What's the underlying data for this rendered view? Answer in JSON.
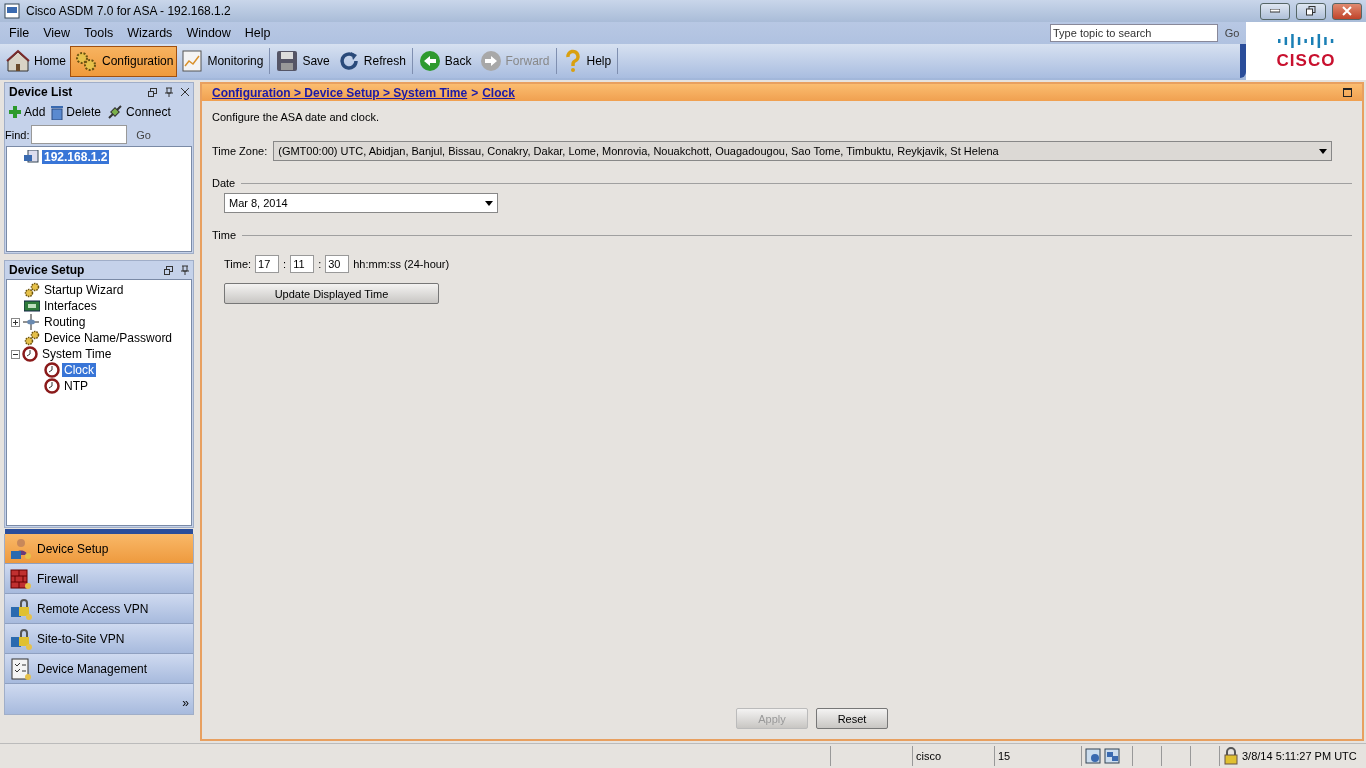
{
  "window": {
    "title": "Cisco ASDM 7.0 for ASA - 192.168.1.2"
  },
  "menu": [
    "File",
    "View",
    "Tools",
    "Wizards",
    "Window",
    "Help"
  ],
  "toolbar": [
    {
      "label": "Home",
      "kind": "home",
      "selected": false,
      "disabled": false
    },
    {
      "label": "Configuration",
      "kind": "gears",
      "selected": true,
      "disabled": false
    },
    {
      "label": "Monitoring",
      "kind": "chart",
      "selected": false,
      "disabled": false
    },
    {
      "label": "Save",
      "kind": "disk",
      "selected": false,
      "disabled": false
    },
    {
      "label": "Refresh",
      "kind": "refresh",
      "selected": false,
      "disabled": false
    },
    {
      "label": "Back",
      "kind": "back",
      "selected": false,
      "disabled": false
    },
    {
      "label": "Forward",
      "kind": "forward",
      "selected": false,
      "disabled": true
    },
    {
      "label": "Help",
      "kind": "question",
      "selected": false,
      "disabled": false
    }
  ],
  "search": {
    "placeholder": "Type topic to search",
    "button": "Go"
  },
  "logo": "CISCO",
  "device_list": {
    "title": "Device List",
    "actions": [
      {
        "label": "Add",
        "kind": "plus"
      },
      {
        "label": "Delete",
        "kind": "trash"
      },
      {
        "label": "Connect",
        "kind": "plug"
      }
    ],
    "find_label": "Find:",
    "find_button": "Go",
    "devices": [
      {
        "label": "192.168.1.2",
        "selected": true
      }
    ]
  },
  "device_setup": {
    "title": "Device Setup",
    "tree": [
      {
        "label": "Startup Wizard",
        "kind": "gear",
        "selected": false
      },
      {
        "label": "Interfaces",
        "kind": "card",
        "selected": false
      },
      {
        "label": "Routing",
        "kind": "routing",
        "selected": false,
        "expanded": false
      },
      {
        "label": "Device Name/Password",
        "kind": "gear",
        "selected": false
      },
      {
        "label": "System Time",
        "kind": "clock",
        "selected": false,
        "expanded": true,
        "children": [
          {
            "label": "Clock",
            "kind": "clock",
            "selected": true
          },
          {
            "label": "NTP",
            "kind": "clock",
            "selected": false
          }
        ]
      }
    ]
  },
  "nav": [
    {
      "label": "Device Setup",
      "kind": "person",
      "selected": true
    },
    {
      "label": "Firewall",
      "kind": "wall",
      "selected": false
    },
    {
      "label": "Remote Access VPN",
      "kind": "lock",
      "selected": false
    },
    {
      "label": "Site-to-Site VPN",
      "kind": "lock",
      "selected": false
    },
    {
      "label": "Device Management",
      "kind": "checklist",
      "selected": false
    },
    {
      "label": "»",
      "kind": "more"
    }
  ],
  "breadcrumb": {
    "path": "Configuration > Device Setup > System Time",
    "separator": ">",
    "current": "Clock"
  },
  "description": "Configure the ASA date and clock.",
  "time_zone": {
    "label": "Time Zone:",
    "value": "(GMT00:00) UTC, Abidjan, Banjul, Bissau, Conakry, Dakar, Lome, Monrovia, Nouakchott, Ouagadougou, Sao Tome, Timbuktu, Reykjavik, St Helena"
  },
  "date": {
    "section": "Date",
    "value": "Mar 8, 2014"
  },
  "time": {
    "section": "Time",
    "label": "Time:",
    "hours": "17",
    "minutes": "11",
    "seconds": "30",
    "separator": ":",
    "format": "hh:mm:ss (24-hour)",
    "button": "Update Displayed Time"
  },
  "buttons": [
    {
      "label": "Apply",
      "disabled": true
    },
    {
      "label": "Reset",
      "disabled": false
    }
  ],
  "status_bar": {
    "user": "cisco",
    "count": "15",
    "datetime": "3/8/14 5:11:27 PM UTC"
  }
}
